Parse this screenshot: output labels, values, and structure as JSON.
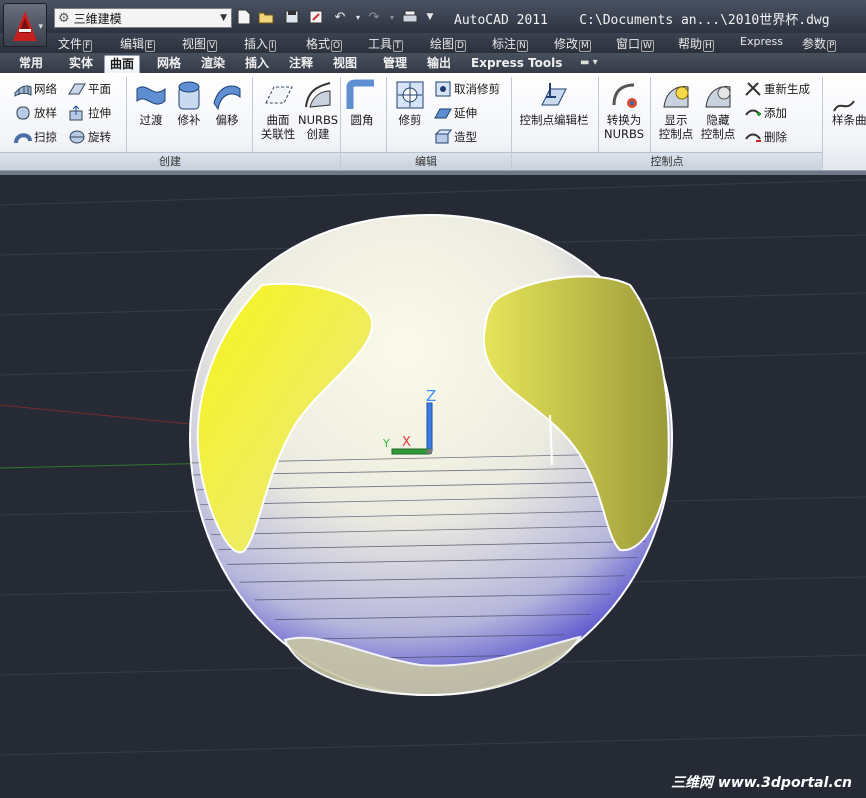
{
  "window": {
    "title": "AutoCAD 2011    C:\\Documents an...\\2010世界杯.dwg"
  },
  "quick_access": {
    "workspace": "三维建模",
    "icons": [
      "new-icon",
      "open-icon",
      "save-icon",
      "saveas-icon",
      "undo-icon",
      "redo-icon",
      "print-icon"
    ]
  },
  "menu": [
    {
      "label": "文件",
      "key": "F"
    },
    {
      "label": "编辑",
      "key": "E"
    },
    {
      "label": "视图",
      "key": "V"
    },
    {
      "label": "插入",
      "key": "I"
    },
    {
      "label": "格式",
      "key": "O"
    },
    {
      "label": "工具",
      "key": "T"
    },
    {
      "label": "绘图",
      "key": "D"
    },
    {
      "label": "标注",
      "key": "N"
    },
    {
      "label": "修改",
      "key": "M"
    },
    {
      "label": "窗口",
      "key": "W"
    },
    {
      "label": "帮助",
      "key": "H"
    },
    {
      "label": "Express",
      "key": ""
    },
    {
      "label": "参数",
      "key": "P"
    }
  ],
  "tabs": [
    "常用",
    "实体",
    "曲面",
    "网格",
    "渲染",
    "插入",
    "注释",
    "视图",
    "管理",
    "输出",
    "Express Tools"
  ],
  "active_tab": "曲面",
  "ribbon": {
    "create": {
      "title": "创建",
      "small": [
        "网络",
        "放样",
        "扫掠",
        "平面",
        "拉伸",
        "旋转"
      ],
      "big": [
        "过渡",
        "修补",
        "偏移"
      ],
      "big2": [
        [
          "曲面",
          "关联性"
        ],
        [
          "NURBS",
          "创建"
        ]
      ]
    },
    "edit": {
      "title": "编辑",
      "big": [
        "圆角",
        "修剪"
      ],
      "small": [
        "取消修剪",
        "延伸",
        "造型"
      ]
    },
    "cv_bar": {
      "label": "控制点编辑栏"
    },
    "control_points": {
      "title": "控制点",
      "big": [
        [
          "转换为",
          "NURBS"
        ],
        [
          "显示",
          "控制点"
        ],
        [
          "隐藏",
          "控制点"
        ]
      ],
      "small": [
        "重新生成",
        "添加",
        "删除"
      ]
    },
    "spline": {
      "label": "样条曲"
    }
  },
  "viewport": {
    "ucs_z": "Z",
    "ucs_y": "Y",
    "ucs_x": "X",
    "colors": {
      "background": "#252a35",
      "sphere_yellow": "#f0ef2a",
      "sphere_blue": "#2a22c8"
    }
  },
  "watermark": "三维网 www.3dportal.cn"
}
